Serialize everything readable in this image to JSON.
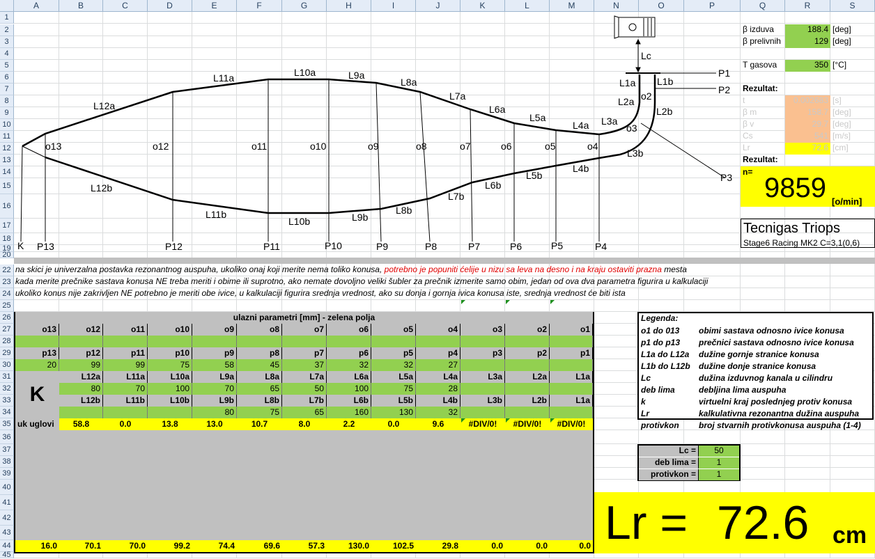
{
  "columns": [
    "A",
    "B",
    "C",
    "D",
    "E",
    "F",
    "G",
    "H",
    "I",
    "J",
    "K",
    "L",
    "M",
    "N",
    "O",
    "P",
    "Q",
    "R",
    "S"
  ],
  "rows": [
    "1",
    "2",
    "3",
    "4",
    "5",
    "6",
    "7",
    "8",
    "9",
    "10",
    "11",
    "12",
    "13",
    "14",
    "15",
    "16",
    "17",
    "18",
    "19",
    "20",
    "22",
    "23",
    "24",
    "25",
    "26",
    "27",
    "28",
    "29",
    "30",
    "31",
    "32",
    "33",
    "34",
    "35",
    "36",
    "37",
    "38",
    "39",
    "40",
    "41",
    "42",
    "43",
    "44",
    "45"
  ],
  "sketch": {
    "upper_labels": [
      "L12a",
      "L11a",
      "L10a",
      "L9a",
      "L8a",
      "L7a",
      "L6a",
      "L5a",
      "L4a",
      "L3a",
      "L2a",
      "L1a",
      "L1b",
      "L2b",
      "L3b"
    ],
    "lower_labels": [
      "L12b",
      "L11b",
      "L10b",
      "L9b",
      "L8b",
      "L7b",
      "L6b",
      "L5b",
      "L4b"
    ],
    "circ_labels": [
      "o13",
      "o12",
      "o11",
      "o10",
      "o9",
      "o8",
      "o7",
      "o6",
      "o5",
      "o4",
      "o3",
      "o2"
    ],
    "p_labels": [
      "K",
      "P13",
      "P12",
      "P11",
      "P10",
      "P9",
      "P8",
      "P7",
      "P6",
      "P5",
      "P4"
    ],
    "p_right": [
      "P1",
      "P2",
      "P3"
    ],
    "lc_label": "Lc"
  },
  "params": {
    "beta_izduva_label": "β izduva",
    "beta_izduva": "188.4",
    "unit_deg": "[deg]",
    "beta_prelivnih_label": "β prelivnih",
    "beta_prelivnih": "129",
    "t_gasova_label": "T gasova",
    "t_gasova": "350",
    "unit_c": "[°C]",
    "rez_label": "Rezultat:",
    "t_label": "t",
    "t_val": "0.002683",
    "t_unit": "[s]",
    "bm_label": "β m",
    "bm_val": "158.7",
    "bm_unit": "[deg]",
    "bv_label": "β v",
    "bv_val": "29.7",
    "bv_unit": "[deg]",
    "cs_label": "Cs",
    "cs_val": "541",
    "cs_unit": "[m/s]",
    "lr_label": "Lr",
    "lr_val": "72.6",
    "lr_unit": "[cm]",
    "rez2_label": "Rezultat:",
    "n_label": "n=",
    "n_val": "9859",
    "n_unit": "[o/min]"
  },
  "brand": {
    "title": "Tecnigas Triops",
    "subtitle": "Stage6 Racing MK2 C=3,1(0,6)"
  },
  "notes": {
    "r22a": "na skici je univerzalna postavka rezonantnog auspuha, ukoliko onaj koji merite nema toliko konusa, ",
    "r22b": "potrebno je popuniti ćelije u nizu sa leva na desno i na kraju ostaviti prazna ",
    "r22c": "mesta",
    "r23": "kada merite prečnike sastava konusa NE treba meriti i obime ili suprotno, ako nemate dovoljno veliki šubler za prečnik izmerite samo obim, jedan od ova dva parametra figurira u kalkulaciji",
    "r24": "ukoliko konus nije zakrivljen NE potrebno je meriti obe ivice, u kalkulaciji figurira srednja vrednost, ako su donja i gornja ivica konusa iste, srednja vrednost će biti ista"
  },
  "table": {
    "title": "ulazni parametri [mm] - zelena polja",
    "o_headers": [
      "o13",
      "o12",
      "o11",
      "o10",
      "o9",
      "o8",
      "o7",
      "o6",
      "o5",
      "o4",
      "o3",
      "o2",
      "o1"
    ],
    "p_headers": [
      "p13",
      "p12",
      "p11",
      "p10",
      "p9",
      "p8",
      "p7",
      "p6",
      "p5",
      "p4",
      "p3",
      "p2",
      "p1"
    ],
    "p_values": [
      "20",
      "99",
      "99",
      "75",
      "58",
      "45",
      "37",
      "32",
      "32",
      "27",
      "",
      "",
      ""
    ],
    "La_headers": [
      "L12a",
      "L11a",
      "L10a",
      "L9a",
      "L8a",
      "L7a",
      "L6a",
      "L5a",
      "L4a",
      "L3a",
      "L2a",
      "L1a"
    ],
    "La_values": [
      "80",
      "70",
      "100",
      "70",
      "65",
      "50",
      "100",
      "75",
      "28",
      "",
      "",
      ""
    ],
    "Lb_headers": [
      "L12b",
      "L11b",
      "L10b",
      "L9b",
      "L8b",
      "L7b",
      "L6b",
      "L5b",
      "L4b",
      "L3b",
      "L2b",
      "L1a"
    ],
    "Lb_values": [
      "",
      "",
      "",
      "80",
      "75",
      "65",
      "160",
      "130",
      "32",
      "",
      "",
      ""
    ],
    "k_label": "K",
    "angles_label": "uk uglovi",
    "angles": [
      "58.8",
      "0.0",
      "13.8",
      "13.0",
      "10.7",
      "8.0",
      "2.2",
      "0.0",
      "9.6",
      "#DIV/0!",
      "#DIV/0!",
      "#DIV/0!"
    ],
    "bottom": [
      "16.0",
      "70.1",
      "70.0",
      "99.2",
      "74.4",
      "69.6",
      "57.3",
      "130.0",
      "102.5",
      "29.8",
      "0.0",
      "0.0",
      "0.0"
    ]
  },
  "legend": {
    "title": "Legenda:",
    "items": [
      {
        "k": "o1 do 013",
        "v": "obimi sastava odnosno ivice konusa"
      },
      {
        "k": "p1 do p13",
        "v": "prečnici sastava odnosno ivice konusa"
      },
      {
        "k": "L1a do L12a",
        "v": "dužine gornje stranice konusa"
      },
      {
        "k": "L1b do L12b",
        "v": "dužine donje stranice konusa"
      },
      {
        "k": "Lc",
        "v": "dužina izduvnog kanala u cilindru"
      },
      {
        "k": "deb lima",
        "v": "debljina lima auspuha"
      },
      {
        "k": "k",
        "v": "virtuelni kraj poslednjeg protiv konusa"
      },
      {
        "k": "Lr",
        "v": "kalkulativna rezonantna dužina auspuha"
      },
      {
        "k": "protivkon",
        "v": "broj stvarnih protivkonusa auspuha (1-4)"
      }
    ]
  },
  "extra": {
    "lc_label": "Lc =",
    "lc_val": "50",
    "deb_label": "deb lima =",
    "deb_val": "1",
    "prot_label": "protivkon =",
    "prot_val": "1"
  },
  "result": {
    "lr_text": "Lr =",
    "lr_val": "72.6",
    "unit": "cm"
  }
}
